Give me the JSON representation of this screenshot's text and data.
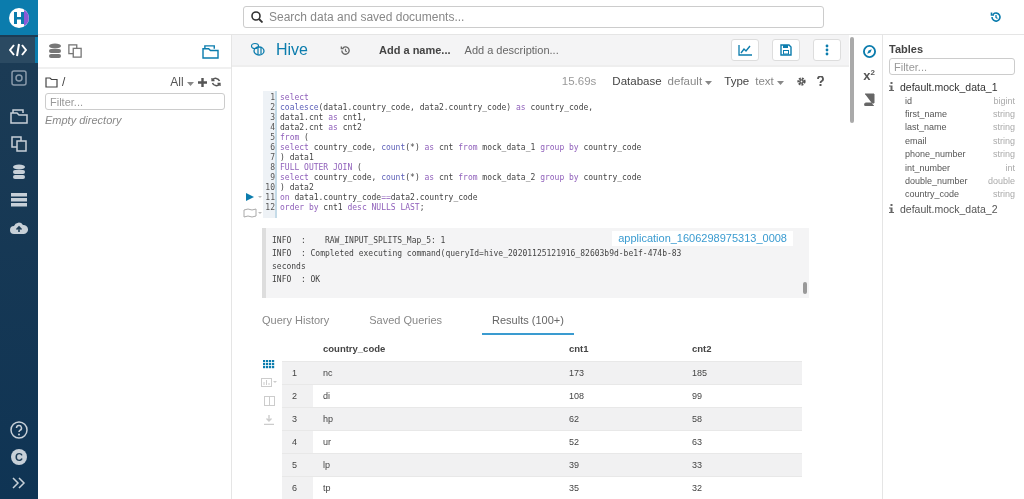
{
  "search": {
    "placeholder": "Search data and saved documents..."
  },
  "nav": [
    {
      "kind": "editor",
      "selected": true
    },
    {
      "kind": "scheduler",
      "selected": false
    },
    {
      "kind": "documents",
      "selected": false
    },
    {
      "kind": "copies",
      "selected": false
    },
    {
      "kind": "database",
      "selected": false
    },
    {
      "kind": "server",
      "selected": false
    },
    {
      "kind": "upload",
      "selected": false
    }
  ],
  "user_initial": "C",
  "files": {
    "path": "/",
    "filter_label": "All",
    "placeholder": "Filter...",
    "empty_text": "Empty directory"
  },
  "editor": {
    "title": "Hive",
    "name_placeholder": "Add a name...",
    "description_placeholder": "Add a description...",
    "duration": "15.69s",
    "database_label": "Database",
    "database": "default",
    "type_label": "Type",
    "type": "text",
    "lines": [
      [
        {
          "text": "select",
          "kind": "keyword"
        }
      ],
      [
        {
          "text": "coalesce",
          "kind": "function"
        },
        {
          "text": "(data1.country_code, data2.country_code) ",
          "kind": "plain"
        },
        {
          "text": "as",
          "kind": "keyword"
        },
        {
          "text": " country_code,",
          "kind": "plain"
        }
      ],
      [
        {
          "text": "data1.cnt ",
          "kind": "plain"
        },
        {
          "text": "as",
          "kind": "keyword"
        },
        {
          "text": " cnt1,",
          "kind": "plain"
        }
      ],
      [
        {
          "text": "data2.cnt ",
          "kind": "plain"
        },
        {
          "text": "as",
          "kind": "keyword"
        },
        {
          "text": " cnt2",
          "kind": "plain"
        }
      ],
      [
        {
          "text": "from",
          "kind": "keyword"
        },
        {
          "text": " (",
          "kind": "plain"
        }
      ],
      [
        {
          "text": "select",
          "kind": "keyword"
        },
        {
          "text": " country_code, ",
          "kind": "plain"
        },
        {
          "text": "count",
          "kind": "function"
        },
        {
          "text": "(*) ",
          "kind": "plain"
        },
        {
          "text": "as",
          "kind": "keyword"
        },
        {
          "text": " cnt ",
          "kind": "plain"
        },
        {
          "text": "from",
          "kind": "keyword"
        },
        {
          "text": " mock_data_1 ",
          "kind": "plain"
        },
        {
          "text": "group by",
          "kind": "keyword"
        },
        {
          "text": " country_code",
          "kind": "plain"
        }
      ],
      [
        {
          "text": ") data1",
          "kind": "plain"
        }
      ],
      [
        {
          "text": "FULL OUTER JOIN",
          "kind": "keyword"
        },
        {
          "text": " (",
          "kind": "plain"
        }
      ],
      [
        {
          "text": "select",
          "kind": "keyword"
        },
        {
          "text": " country_code, ",
          "kind": "plain"
        },
        {
          "text": "count",
          "kind": "function"
        },
        {
          "text": "(*) ",
          "kind": "plain"
        },
        {
          "text": "as",
          "kind": "keyword"
        },
        {
          "text": " cnt ",
          "kind": "plain"
        },
        {
          "text": "from",
          "kind": "keyword"
        },
        {
          "text": " mock_data_2 ",
          "kind": "plain"
        },
        {
          "text": "group by",
          "kind": "keyword"
        },
        {
          "text": " country_code",
          "kind": "plain"
        }
      ],
      [
        {
          "text": ") data2",
          "kind": "plain"
        }
      ],
      [
        {
          "text": "on",
          "kind": "keyword"
        },
        {
          "text": " data1.country_code",
          "kind": "plain"
        },
        {
          "text": "==",
          "kind": "keyword"
        },
        {
          "text": "data2.country_code",
          "kind": "plain"
        }
      ],
      [
        {
          "text": "order by",
          "kind": "keyword"
        },
        {
          "text": " cnt1 ",
          "kind": "plain"
        },
        {
          "text": "desc NULLS LAST",
          "kind": "keyword"
        },
        {
          "text": ";",
          "kind": "plain"
        }
      ]
    ],
    "line_numbers": [
      "1",
      "2",
      "3",
      "4",
      "5",
      "6",
      "7",
      "8",
      "9",
      "10",
      "11",
      "12"
    ]
  },
  "log": {
    "lines": [
      "INFO  :    RAW_INPUT_SPLITS_Map_5: 1",
      "INFO  : Completed executing command(queryId=hive_20201125121916_82603b9d-be1f-474b-83",
      "seconds",
      "INFO  : OK"
    ],
    "job_link": "application_1606298975313_0008"
  },
  "tabs": [
    {
      "label": "Query History",
      "selected": false
    },
    {
      "label": "Saved Queries",
      "selected": false
    },
    {
      "label": "Results (100+)",
      "selected": true
    }
  ],
  "table": {
    "columns": [
      "",
      "country_code",
      "cnt1",
      "cnt2"
    ],
    "rows": [
      [
        "1",
        "nc",
        "173",
        "185"
      ],
      [
        "2",
        "di",
        "108",
        "99"
      ],
      [
        "3",
        "hp",
        "62",
        "58"
      ],
      [
        "4",
        "ur",
        "52",
        "63"
      ],
      [
        "5",
        "lp",
        "39",
        "33"
      ],
      [
        "6",
        "tp",
        "35",
        "32"
      ]
    ]
  },
  "functions_label": "x$^{2}$",
  "assist": {
    "title": "Tables",
    "placeholder": "Filter...",
    "tables": [
      {
        "name": "default.mock_data_1",
        "expanded": true,
        "columns": [
          {
            "name": "id",
            "type": "bigint"
          },
          {
            "name": "first_name",
            "type": "string"
          },
          {
            "name": "last_name",
            "type": "string"
          },
          {
            "name": "email",
            "type": "string"
          },
          {
            "name": "phone_number",
            "type": "string"
          },
          {
            "name": "int_number",
            "type": "int"
          },
          {
            "name": "double_number",
            "type": "double"
          },
          {
            "name": "country_code",
            "type": "string"
          }
        ]
      },
      {
        "name": "default.mock_data_2",
        "expanded": false
      }
    ]
  }
}
